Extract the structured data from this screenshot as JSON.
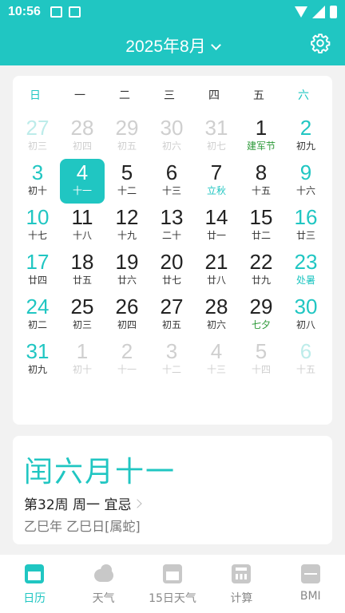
{
  "status": {
    "time": "10:56"
  },
  "header": {
    "month": "2025年8月"
  },
  "weekdays": [
    "日",
    "一",
    "二",
    "三",
    "四",
    "五",
    "六"
  ],
  "calendar": [
    {
      "d": "27",
      "l": "初三",
      "t": "other weekend"
    },
    {
      "d": "28",
      "l": "初四",
      "t": "other"
    },
    {
      "d": "29",
      "l": "初五",
      "t": "other"
    },
    {
      "d": "30",
      "l": "初六",
      "t": "other"
    },
    {
      "d": "31",
      "l": "初七",
      "t": "other"
    },
    {
      "d": "1",
      "l": "建军节",
      "t": "festival"
    },
    {
      "d": "2",
      "l": "初九",
      "t": "weekend"
    },
    {
      "d": "3",
      "l": "初十",
      "t": "weekend"
    },
    {
      "d": "4",
      "l": "十一",
      "t": "selected"
    },
    {
      "d": "5",
      "l": "十二",
      "t": ""
    },
    {
      "d": "6",
      "l": "十三",
      "t": ""
    },
    {
      "d": "7",
      "l": "立秋",
      "t": "term"
    },
    {
      "d": "8",
      "l": "十五",
      "t": ""
    },
    {
      "d": "9",
      "l": "十六",
      "t": "weekend"
    },
    {
      "d": "10",
      "l": "十七",
      "t": "weekend"
    },
    {
      "d": "11",
      "l": "十八",
      "t": ""
    },
    {
      "d": "12",
      "l": "十九",
      "t": ""
    },
    {
      "d": "13",
      "l": "二十",
      "t": ""
    },
    {
      "d": "14",
      "l": "廿一",
      "t": ""
    },
    {
      "d": "15",
      "l": "廿二",
      "t": ""
    },
    {
      "d": "16",
      "l": "廿三",
      "t": "weekend"
    },
    {
      "d": "17",
      "l": "廿四",
      "t": "weekend"
    },
    {
      "d": "18",
      "l": "廿五",
      "t": ""
    },
    {
      "d": "19",
      "l": "廿六",
      "t": ""
    },
    {
      "d": "20",
      "l": "廿七",
      "t": ""
    },
    {
      "d": "21",
      "l": "廿八",
      "t": ""
    },
    {
      "d": "22",
      "l": "廿九",
      "t": ""
    },
    {
      "d": "23",
      "l": "处暑",
      "t": "weekend term"
    },
    {
      "d": "24",
      "l": "初二",
      "t": "weekend"
    },
    {
      "d": "25",
      "l": "初三",
      "t": ""
    },
    {
      "d": "26",
      "l": "初四",
      "t": ""
    },
    {
      "d": "27",
      "l": "初五",
      "t": ""
    },
    {
      "d": "28",
      "l": "初六",
      "t": ""
    },
    {
      "d": "29",
      "l": "七夕",
      "t": "festival"
    },
    {
      "d": "30",
      "l": "初八",
      "t": "weekend"
    },
    {
      "d": "31",
      "l": "初九",
      "t": "weekend"
    },
    {
      "d": "1",
      "l": "初十",
      "t": "other"
    },
    {
      "d": "2",
      "l": "十一",
      "t": "other"
    },
    {
      "d": "3",
      "l": "十二",
      "t": "other"
    },
    {
      "d": "4",
      "l": "十三",
      "t": "other"
    },
    {
      "d": "5",
      "l": "十四",
      "t": "other"
    },
    {
      "d": "6",
      "l": "十五",
      "t": "other weekend"
    }
  ],
  "info": {
    "lunar_date": "闰六月十一",
    "week_info": "第32周 周一 宜忌",
    "ganzhi": "乙巳年 乙巳日[属蛇]"
  },
  "nav": [
    {
      "label": "日历",
      "icon": "calendar-icon"
    },
    {
      "label": "天气",
      "icon": "weather-icon"
    },
    {
      "label": "15日天气",
      "icon": "forecast-icon"
    },
    {
      "label": "计算",
      "icon": "calculator-icon"
    },
    {
      "label": "BMI",
      "icon": "bmi-icon"
    }
  ],
  "colors": {
    "accent": "#20c6c2",
    "festival": "#2e9a3a"
  }
}
